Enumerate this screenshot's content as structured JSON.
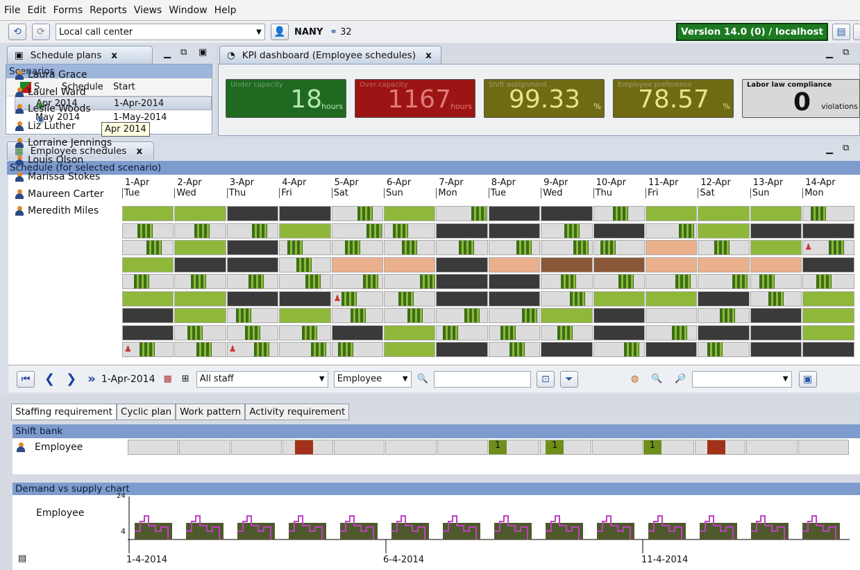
{
  "menu": [
    "File",
    "Edit",
    "Forms",
    "Reports",
    "Views",
    "Window",
    "Help"
  ],
  "toolbar": {
    "location": "Local call center",
    "user": "NANY",
    "count": "32",
    "version": "Version 14.0 (0) / localhost"
  },
  "plans": {
    "tab": "Schedule plans",
    "section": "Scenarios",
    "columns": [
      "S...",
      "Schedule",
      "Start"
    ],
    "rows": [
      {
        "name": "Apr 2014",
        "start": "1-Apr-2014"
      },
      {
        "name": "May 2014",
        "start": "1-May-2014"
      }
    ],
    "tooltip": "Apr 2014"
  },
  "kpi": {
    "tab": "KPI dashboard (Employee schedules)",
    "items": [
      {
        "label": "Under capacity",
        "value": "18",
        "unit": "hours",
        "bg": "#1f6a20"
      },
      {
        "label": "Over capacity",
        "value": "1167",
        "unit": "hours",
        "bg": "#9c1414"
      },
      {
        "label": "Shift assignment",
        "value": "99.33",
        "unit": "%",
        "bg": "#6f6a14"
      },
      {
        "label": "Employee preference",
        "value": "78.57",
        "unit": "%",
        "bg": "#6f6a14"
      },
      {
        "label": "Labor law compliance",
        "value": "0",
        "unit": "violations",
        "bg": "#d8d8d8"
      }
    ]
  },
  "sched": {
    "tab": "Employee schedules",
    "title": "Schedule (for selected scenario)",
    "days": [
      {
        "d": "1-Apr",
        "w": "Tue"
      },
      {
        "d": "2-Apr",
        "w": "Wed"
      },
      {
        "d": "3-Apr",
        "w": "Thu"
      },
      {
        "d": "4-Apr",
        "w": "Fri"
      },
      {
        "d": "5-Apr",
        "w": "Sat"
      },
      {
        "d": "6-Apr",
        "w": "Sun"
      },
      {
        "d": "7-Apr",
        "w": "Mon"
      },
      {
        "d": "8-Apr",
        "w": "Tue"
      },
      {
        "d": "9-Apr",
        "w": "Wed"
      },
      {
        "d": "10-Apr",
        "w": "Thu"
      },
      {
        "d": "11-Apr",
        "w": "Fri"
      },
      {
        "d": "12-Apr",
        "w": "Sat"
      },
      {
        "d": "13-Apr",
        "w": "Sun"
      },
      {
        "d": "14-Apr",
        "w": "Mon"
      }
    ],
    "employees": [
      "Laura Grace",
      "Laurel Ward",
      "Leslie Woods",
      "Liz Luther",
      "Lorraine Jennings",
      "Louis Olson",
      "Marissa Stokes",
      "Maureen Carter",
      "Meredith Miles"
    ],
    "rows": [
      "ogddsoxddlooox",
      "bvxoslddwdsgdd",
      "yodyxsbbywpvoc",
      "gddbppdppppppd",
      "xbsblbddbbxsxt",
      "ogddcbddxgadxg",
      "dgbgsbybgdebdg",
      "dbbxdgbbbdbddg",
      "cvcvyadbdbdbdd"
    ]
  },
  "nav": {
    "date": "1-Apr-2014",
    "filter": "All staff",
    "type": "Employee"
  },
  "bottom": {
    "tabs": [
      "Staffing requirement",
      "Cyclic plan",
      "Work pattern",
      "Activity requirement"
    ],
    "shiftbank": "Shift bank",
    "emp": "Employee",
    "ones": [
      "1",
      "1",
      "1"
    ],
    "chart_title": "Demand vs supply chart",
    "chart_emp": "Employee",
    "ytop": "24",
    "ybot": "4",
    "dates": [
      "1-4-2014",
      "6-4-2014",
      "11-4-2014"
    ]
  }
}
